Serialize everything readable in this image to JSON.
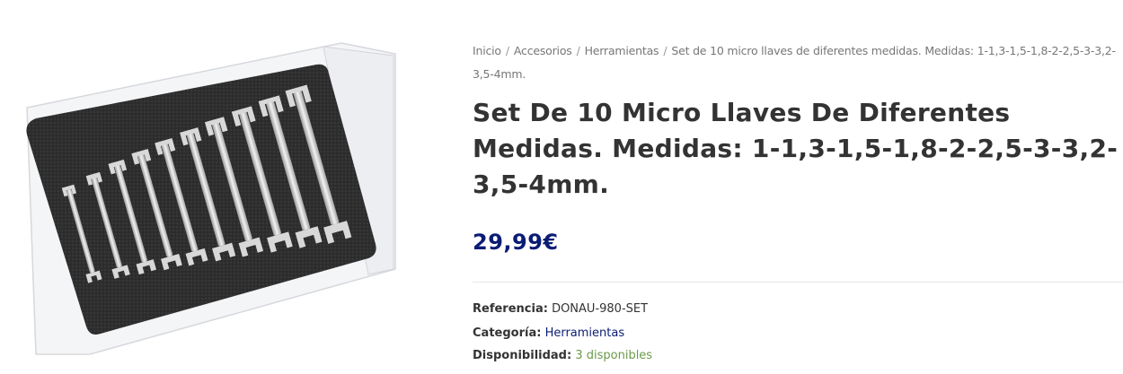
{
  "breadcrumb": {
    "items": [
      {
        "label": "Inicio"
      },
      {
        "label": "Accesorios"
      },
      {
        "label": "Herramientas"
      }
    ],
    "current": "Set de 10 micro llaves de diferentes medidas. Medidas: 1-1,3-1,5-1,8-2-2,5-3-3,2-3,5-4mm.",
    "separator": "/"
  },
  "product": {
    "title": "Set De 10 Micro Llaves De Diferentes Medidas. Medidas: 1-1,3-1,5-1,8-2-2,5-3-3,2-3,5-4mm.",
    "price": "29,99€",
    "sku_label": "Referencia:",
    "sku_value": "DONAU-980-SET",
    "category_label": "Categoría:",
    "category_value": "Herramientas",
    "stock_label": "Disponibilidad:",
    "stock_value": "3 disponibles"
  },
  "colors": {
    "price": "#0b1c75",
    "link": "#0b1c75",
    "stock": "#6a9a4a"
  }
}
